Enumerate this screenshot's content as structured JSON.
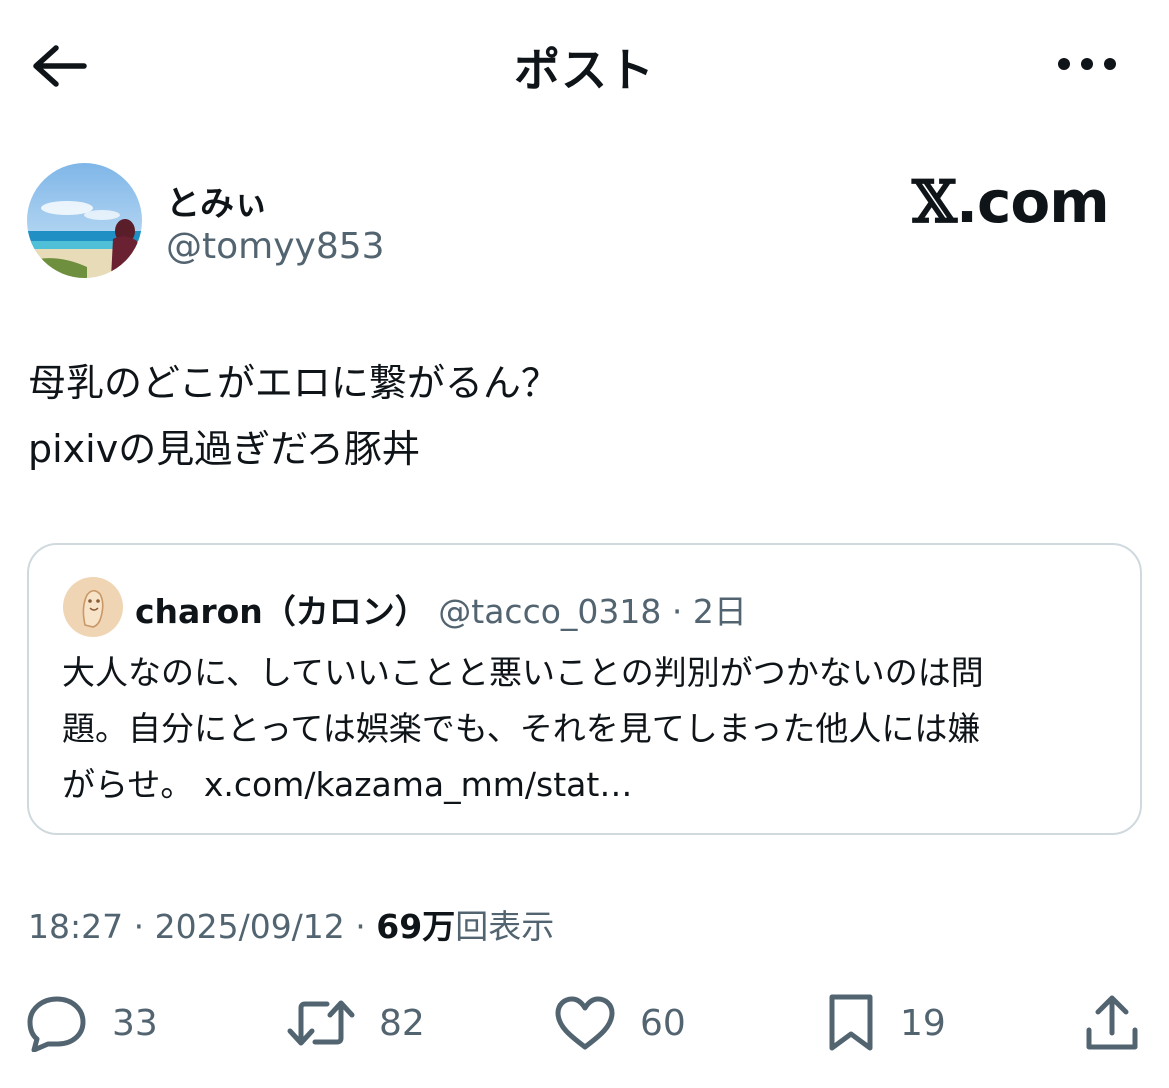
{
  "header": {
    "title": "ポスト",
    "back_icon": "arrow-left-icon",
    "more_icon": "more-horizontal-icon"
  },
  "author": {
    "display_name": "とみぃ",
    "handle": "@tomyy853",
    "avatar": "beach-photo-avatar"
  },
  "watermark": {
    "x_mark": "𝕏",
    "text": ".com"
  },
  "tweet": {
    "lines": [
      "母乳のどこがエロに繋がるん？",
      "pixivの見過ぎだろ豚丼"
    ]
  },
  "quote": {
    "name": "charon（カロン）",
    "handle": "@tacco_0318",
    "separator": " · ",
    "time": "2日",
    "lines": [
      "大人なのに、していいことと悪いことの判別がつかないのは問",
      "題。自分にとっては娯楽でも、それを見てしまった他人には嫌",
      "がらせ。 x.com/kazama_mm/stat…"
    ]
  },
  "meta": {
    "time": "18:27",
    "sep1": " · ",
    "date": "2025/09/12",
    "sep2": " · ",
    "views_count": "69万",
    "views_label": "回表示"
  },
  "actions": {
    "replies": "33",
    "reposts": "82",
    "likes": "60",
    "bookmarks": "19"
  },
  "colors": {
    "text": "#0f1419",
    "secondary": "#536471",
    "border": "#cfd9de"
  }
}
